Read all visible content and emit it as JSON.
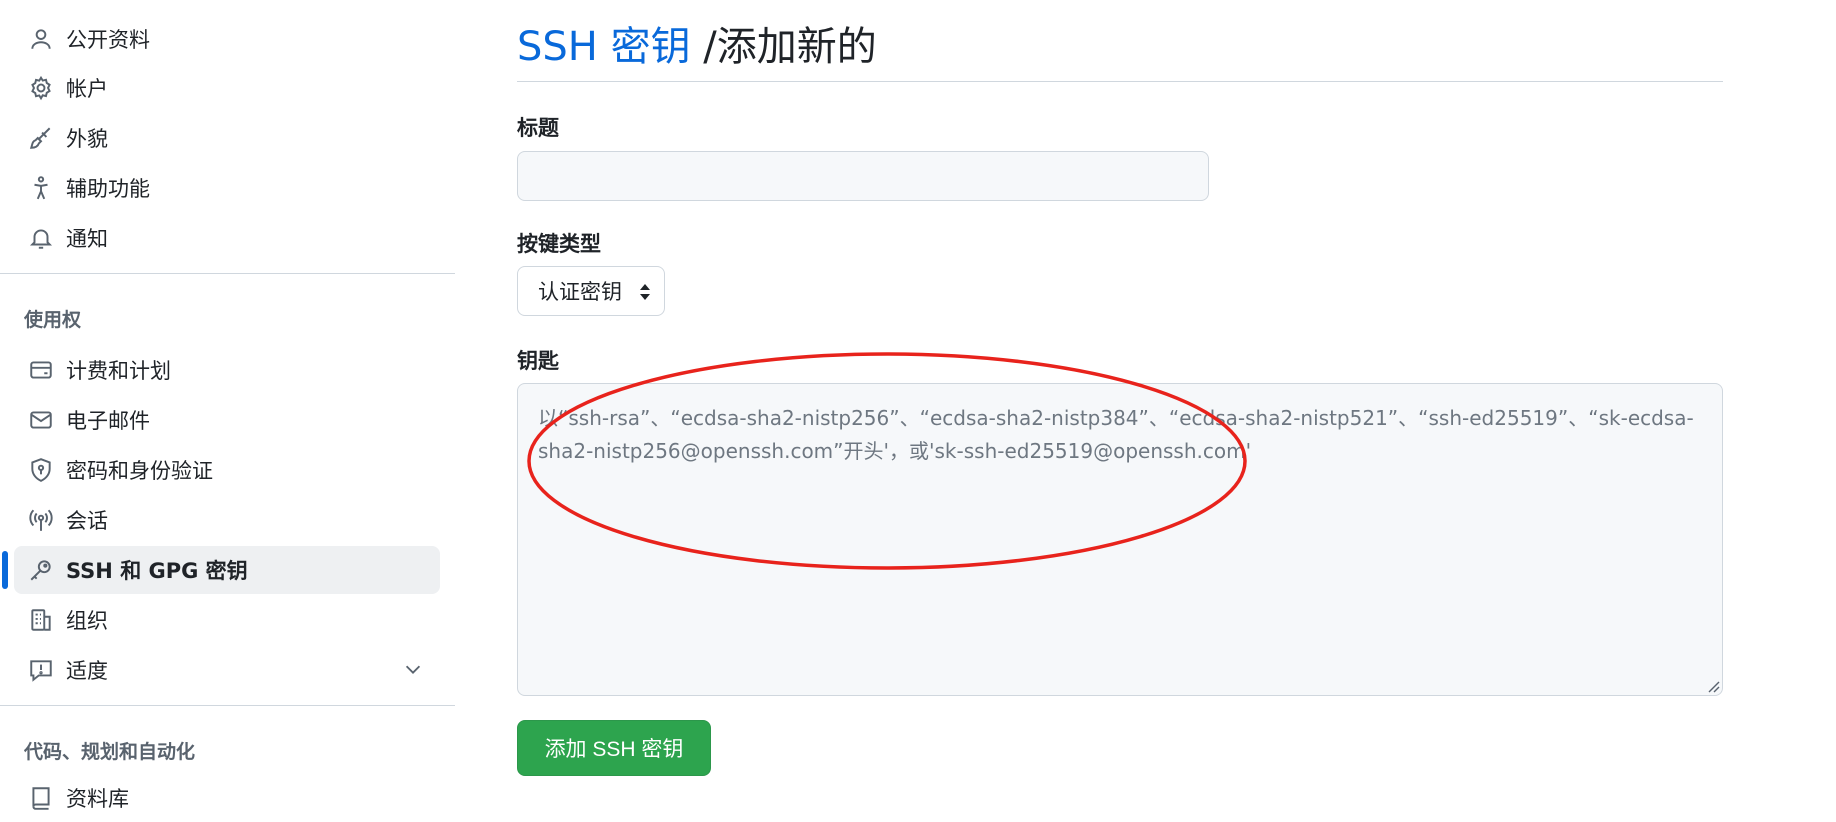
{
  "sidebar": {
    "items": [
      {
        "label": "公开资料",
        "icon": "person-icon"
      },
      {
        "label": "帐户",
        "icon": "gear-icon"
      },
      {
        "label": "外貌",
        "icon": "paintbrush-icon"
      },
      {
        "label": "辅助功能",
        "icon": "accessibility-icon"
      },
      {
        "label": "通知",
        "icon": "bell-icon"
      }
    ],
    "access_title": "使用权",
    "access_items": [
      {
        "label": "计费和计划",
        "icon": "credit-card-icon"
      },
      {
        "label": "电子邮件",
        "icon": "mail-icon"
      },
      {
        "label": "密码和身份验证",
        "icon": "shield-lock-icon"
      },
      {
        "label": "会话",
        "icon": "broadcast-icon"
      },
      {
        "label": "SSH 和 GPG 密钥",
        "icon": "key-icon",
        "active": true
      },
      {
        "label": "组织",
        "icon": "organization-icon"
      },
      {
        "label": "适度",
        "icon": "report-icon",
        "expandable": true
      }
    ],
    "code_title": "代码、规划和自动化",
    "code_items": [
      {
        "label": "资料库",
        "icon": "repo-icon"
      }
    ]
  },
  "main": {
    "title_link": "SSH 密钥",
    "title_rest": " /添加新的",
    "title_label": "标题",
    "title_value": "",
    "key_type_label": "按键类型",
    "key_type_selected": "认证密钥",
    "key_label": "钥匙",
    "key_placeholder": "以“ssh-rsa”、“ecdsa-sha2-nistp256”、“ecdsa-sha2-nistp384”、“ecdsa-sha2-nistp521”、“ssh-ed25519”、“sk-ecdsa-sha2-nistp256@openssh.com”开头'，或'sk-ssh-ed25519@openssh.com'",
    "submit_label": "添加 SSH 密钥"
  },
  "colors": {
    "link": "#0969da",
    "primary": "#2da44e",
    "annotation": "#e8231c",
    "active_bar": "#0969da"
  }
}
